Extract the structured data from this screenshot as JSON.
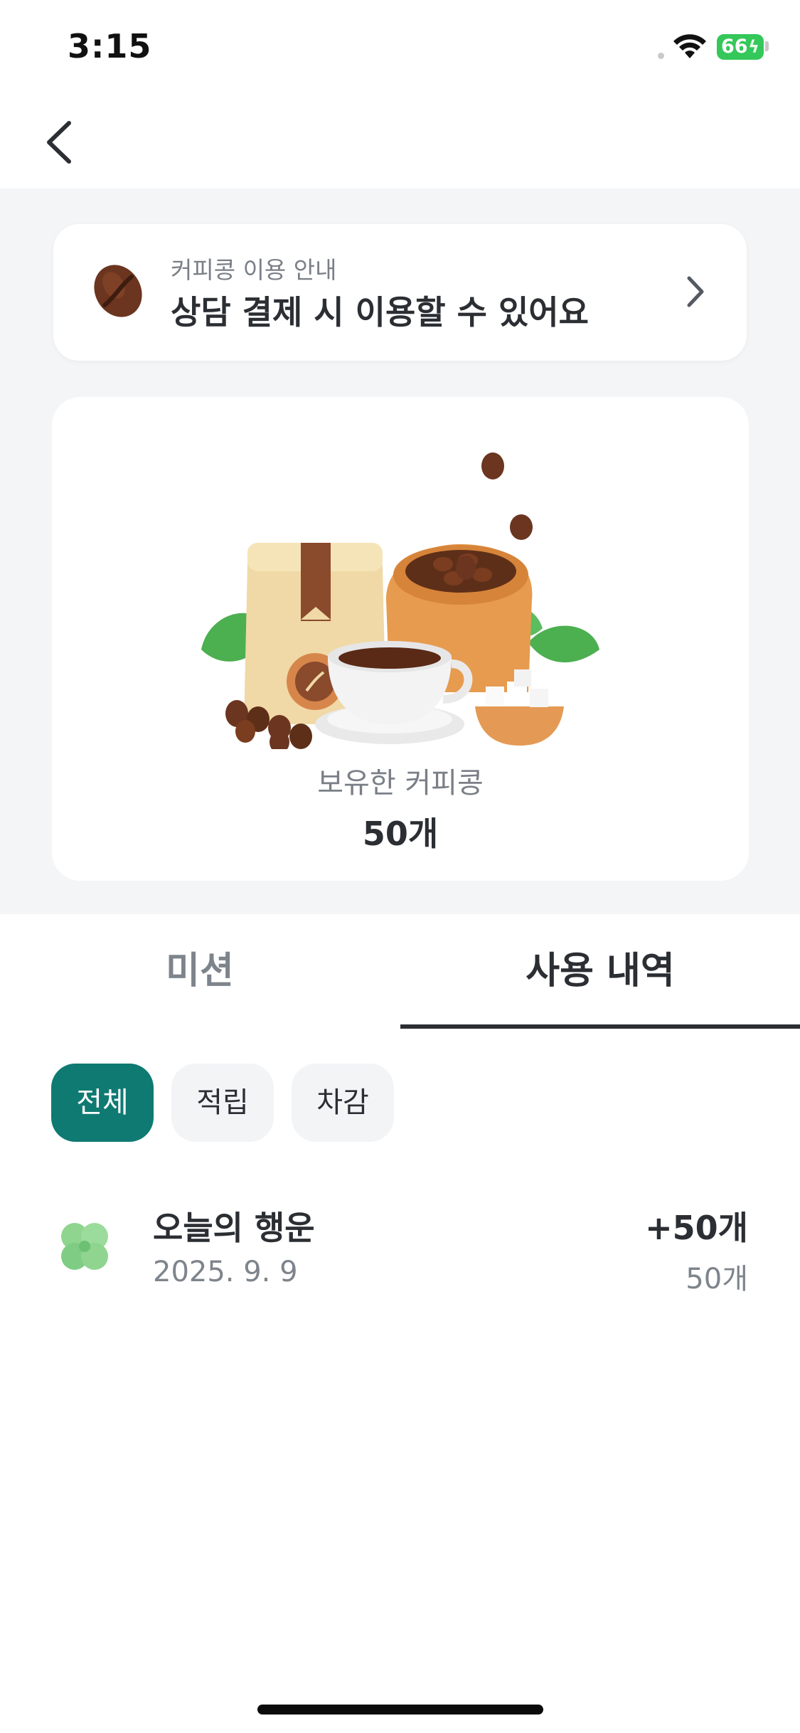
{
  "status_bar": {
    "time": "3:15",
    "battery": "66"
  },
  "info_card": {
    "subtitle": "커피콩 이용 안내",
    "title": "상담 결제 시 이용할 수 있어요"
  },
  "balance_card": {
    "label": "보유한 커피콩",
    "count": "50개"
  },
  "tabs": [
    {
      "label": "미션"
    },
    {
      "label": "사용 내역"
    }
  ],
  "active_tab": "사용 내역",
  "filters": [
    {
      "label": "전체"
    },
    {
      "label": "적립"
    },
    {
      "label": "차감"
    }
  ],
  "active_filter": "전체",
  "history": [
    {
      "title": "오늘의 행운",
      "date": "2025. 9. 9",
      "amount": "+50개",
      "balance": "50개",
      "icon": "clover-icon"
    }
  ],
  "colors": {
    "accent": "#0f7a72",
    "background_grey": "#f4f5f7",
    "battery_green": "#34c759"
  }
}
